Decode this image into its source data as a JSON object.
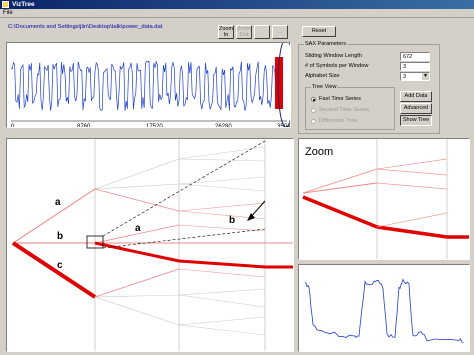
{
  "window": {
    "title": "VizTree"
  },
  "menu": {
    "file": "File"
  },
  "file_path": "C:\\Documents and Settings\\jlin\\Desktop\\talk\\power_data.dat",
  "toolbar": {
    "zoom_in": "Zoom In",
    "zoom_out": "Zoom Out",
    "btn3": "",
    "btn4": "..."
  },
  "reset_label": "Reset",
  "sax": {
    "group_label": "SAX Parameters",
    "sliding_window_label": "Sliding Window Length",
    "sliding_window_value": "672",
    "symbols_label": "# of Symbols per Window",
    "symbols_value": "3",
    "alphabet_label": "Alphabet Size",
    "alphabet_value": "3"
  },
  "tree_view": {
    "group_label": "Tree View",
    "options": [
      "Fast Time Series",
      "Second Time Series",
      "Difference Tree"
    ],
    "selected": 0
  },
  "buttons": {
    "add_data": "Add Data",
    "advanced": "Advanced",
    "show_tree": "Show Tree"
  },
  "series_axis": {
    "ticks": [
      "0",
      "8760",
      "17520",
      "26280",
      "35040"
    ]
  },
  "tree": {
    "labels": [
      "a",
      "b",
      "c",
      "a",
      "b"
    ]
  },
  "zoom": {
    "title": "Zoom"
  },
  "colors": {
    "accent": "#e00000",
    "series": "#1f3fd0",
    "titlebar": "#0a246a"
  }
}
